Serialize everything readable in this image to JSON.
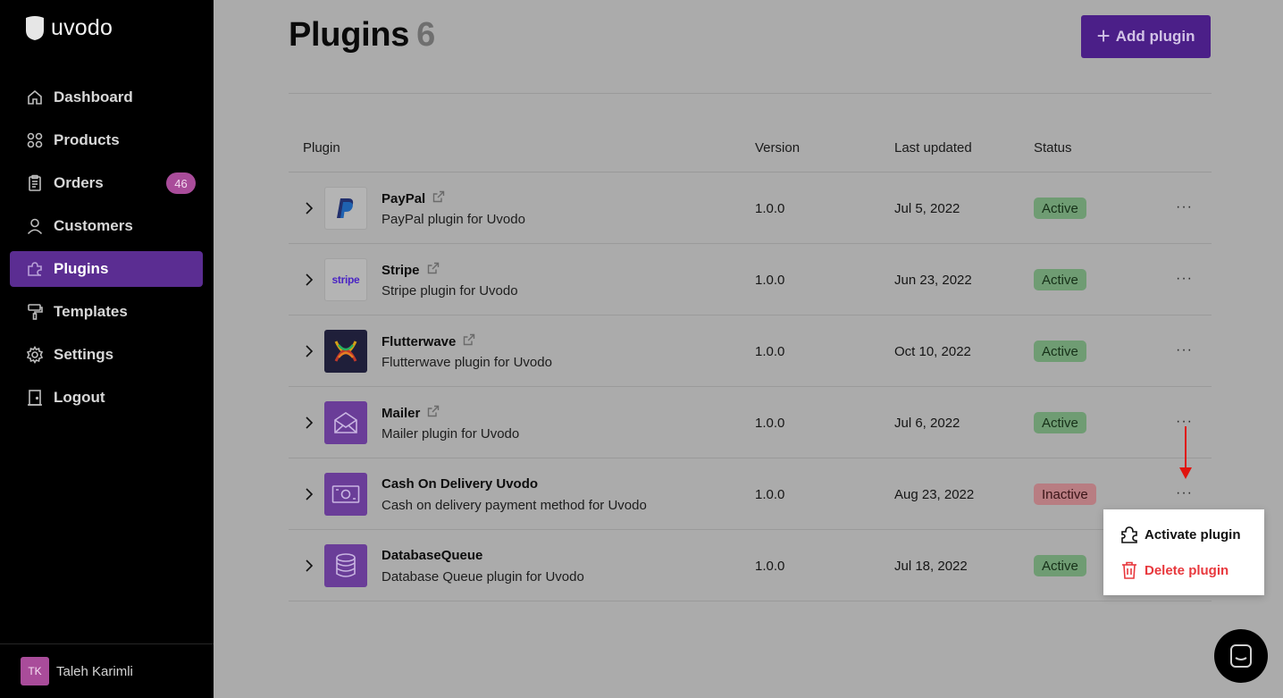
{
  "app": {
    "brand": "uvodo"
  },
  "sidebar": {
    "items": [
      {
        "label": "Dashboard",
        "icon": "home-icon"
      },
      {
        "label": "Products",
        "icon": "grid-icon"
      },
      {
        "label": "Orders",
        "icon": "clipboard-icon",
        "badge": "46"
      },
      {
        "label": "Customers",
        "icon": "person-icon"
      },
      {
        "label": "Plugins",
        "icon": "puzzle-icon",
        "active": true
      },
      {
        "label": "Templates",
        "icon": "paint-roller-icon"
      },
      {
        "label": "Settings",
        "icon": "gear-icon"
      },
      {
        "label": "Logout",
        "icon": "door-icon"
      }
    ],
    "user": {
      "initials": "TK",
      "name": "Taleh Karimli"
    }
  },
  "header": {
    "title": "Plugins",
    "count": "6",
    "add_button": "Add plugin"
  },
  "table": {
    "columns": {
      "plugin": "Plugin",
      "version": "Version",
      "updated": "Last updated",
      "status": "Status"
    },
    "rows": [
      {
        "name": "PayPal",
        "desc": "PayPal plugin for Uvodo",
        "version": "1.0.0",
        "updated": "Jul 5, 2022",
        "status": "Active",
        "logo": "paypal"
      },
      {
        "name": "Stripe",
        "desc": "Stripe plugin for Uvodo",
        "version": "1.0.0",
        "updated": "Jun 23, 2022",
        "status": "Active",
        "logo": "stripe",
        "logo_text": "stripe"
      },
      {
        "name": "Flutterwave",
        "desc": "Flutterwave plugin for Uvodo",
        "version": "1.0.0",
        "updated": "Oct 10, 2022",
        "status": "Active",
        "logo": "flutterwave"
      },
      {
        "name": "Mailer",
        "desc": "Mailer plugin for Uvodo",
        "version": "1.0.0",
        "updated": "Jul 6, 2022",
        "status": "Active",
        "logo": "mail"
      },
      {
        "name": "Cash On Delivery Uvodo",
        "desc": "Cash on delivery payment method for Uvodo",
        "version": "1.0.0",
        "updated": "Aug 23, 2022",
        "status": "Inactive",
        "logo": "cash"
      },
      {
        "name": "DatabaseQueue",
        "desc": "Database Queue plugin for Uvodo",
        "version": "1.0.0",
        "updated": "Jul 18, 2022",
        "status": "Active",
        "logo": "database"
      }
    ],
    "row_menu": "···"
  },
  "dropdown": {
    "activate": "Activate plugin",
    "delete": "Delete plugin"
  },
  "colors": {
    "accent": "#5b2d92",
    "danger": "#e8383d",
    "active_badge": "#6f9c73",
    "inactive_badge": "#b87d82",
    "annotation_arrow": "#e0140f"
  }
}
